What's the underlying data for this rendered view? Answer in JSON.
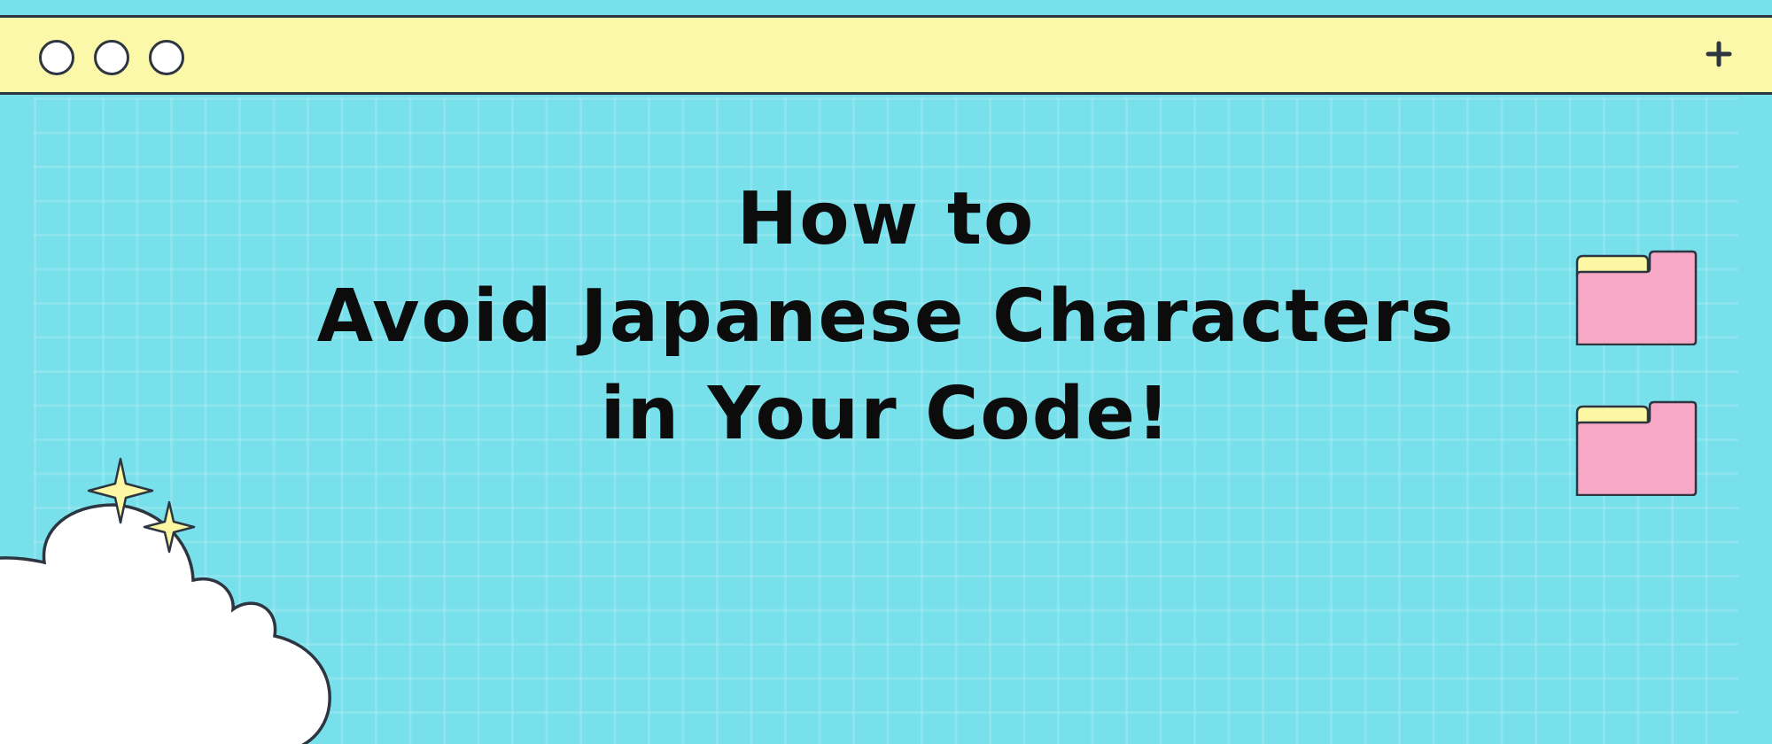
{
  "theme": {
    "background": "#78e0eb",
    "titlebar": "#fbf8aa",
    "outline": "#2d3540",
    "folder_body": "#f6a8c6",
    "folder_tab": "#fbf7a3",
    "cloud": "#ffffff",
    "sparkle": "#fbf7a3"
  },
  "window": {
    "controls": [
      "circle-button",
      "circle-button",
      "circle-button"
    ],
    "plus_icon": "plus-icon"
  },
  "headline": {
    "line1": "How to",
    "line2": "Avoid Japanese Characters",
    "line3": "in Your Code!"
  },
  "decorations": [
    "folder-icon",
    "folder-icon",
    "cloud-shape",
    "sparkle-icon",
    "sparkle-icon"
  ]
}
